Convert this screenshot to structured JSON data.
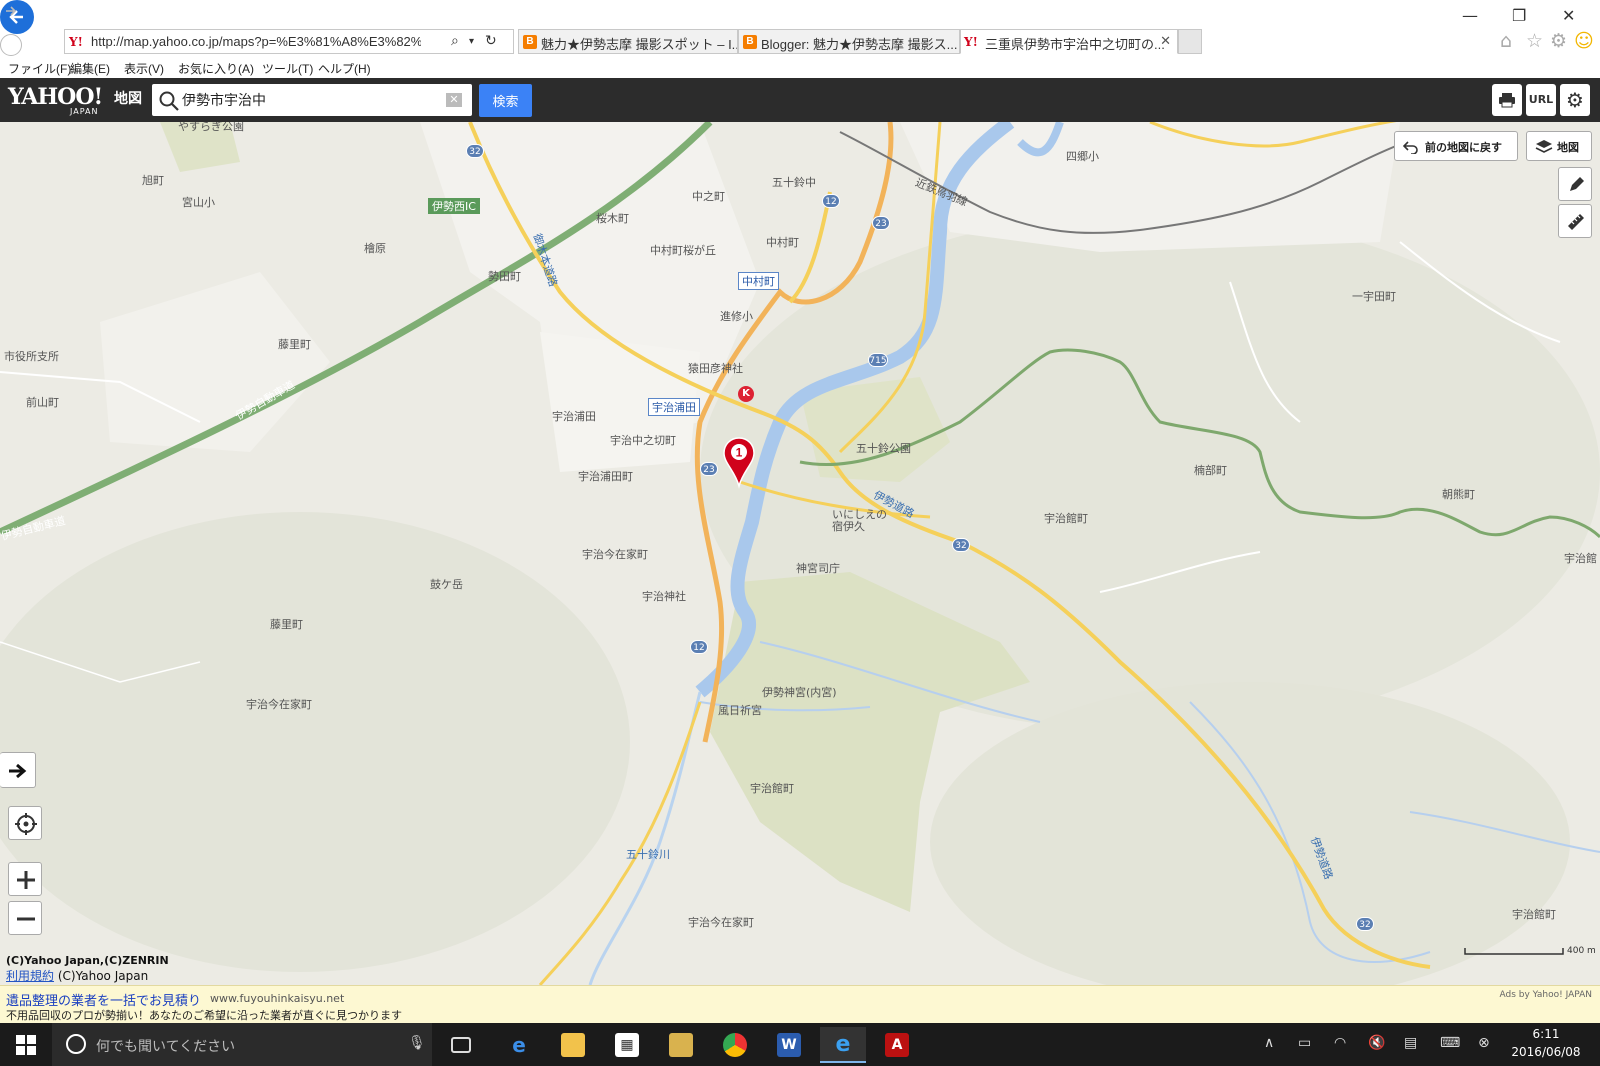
{
  "browser": {
    "url": "http://map.yahoo.co.jp/maps?p=%E3%81%A8%E3%82%82%",
    "tabs": [
      {
        "label": "魅力★伊勢志摩 撮影スポット – I..."
      },
      {
        "label": "Blogger: 魅力★伊勢志摩 撮影ス..."
      },
      {
        "label": "三重県伊勢市宇治中之切町の..."
      }
    ],
    "menu": [
      "ファイル(F)",
      "編集(E)",
      "表示(V)",
      "お気に入り(A)",
      "ツール(T)",
      "ヘルプ(H)"
    ]
  },
  "header": {
    "logo": "YAHOO!",
    "logo_sub": "JAPAN",
    "logo_map": "地図",
    "search_value": "伊勢市宇治中",
    "search_button": "検索",
    "url_button": "URL"
  },
  "map": {
    "prev_map_button": "前の地図に戻す",
    "layer_button": "地図",
    "copyright": "(C)Yahoo Japan,(C)ZENRIN",
    "terms_link": "利用規約",
    "terms_rest": " (C)Yahoo Japan",
    "scale_label": "400 m",
    "marker_number": "1",
    "labels": {
      "yasuragi": "やすらぎ公園",
      "asahi": "旭町",
      "miyayama": "宮山小",
      "ise_nishi_ic": "伊勢西IC",
      "hiki": "檜原",
      "seta": "勢田町",
      "fujisato": "藤里町",
      "shiyakusho": "市役所支所",
      "maeyama": "前山町",
      "ise_expressway1": "伊勢自動車道",
      "ise_expressway2": "伊勢自動車道",
      "sakuragi": "桜木町",
      "nakano": "中之町",
      "isuzu_jh": "五十鈴中",
      "nakamura": "中村町",
      "nakamura_sakura": "中村町桜が丘",
      "nakamura_st": "中村町",
      "shinshu": "進修小",
      "sarutahiko": "猿田彦神社",
      "ujiurata_st": "宇治浦田",
      "ujiurata": "宇治浦田",
      "uji_nakanokiri": "宇治中之切町",
      "ujiurata_machi": "宇治浦田町",
      "isuzu_park": "五十鈴公園",
      "inishie": "いにしえの",
      "inishie2": "宿伊久",
      "ise_michi": "伊勢道路",
      "jingu_shicho": "神宮司庁",
      "uji_imazaike1": "宇治今在家町",
      "kodaka": "鼓ケ岳",
      "uji_jinja": "宇治神社",
      "fujisato2": "藤里町",
      "uji_imazaike2": "宇治今在家町",
      "naiku": "伊勢神宮(内宮)",
      "kazahinomi": "風日祈宮",
      "uji_tachi1": "宇治館町",
      "isuzugawa": "五十鈴川",
      "uji_imazaike3": "宇治今在家町",
      "kintetsu": "近鉄鳥羽線",
      "yonegi": "四郷小",
      "ichiuda": "一宇田町",
      "kusube": "楠部町",
      "uji_tachi2": "宇治館町",
      "asama": "朝熊町",
      "uji_tachi3": "宇治館",
      "uji_tachi4": "宇治館町",
      "ise_michi2": "伊勢道路",
      "okimotomichi": "御木本道路"
    },
    "routes": [
      "32",
      "12",
      "23",
      "23",
      "12",
      "32",
      "715",
      "32"
    ]
  },
  "ad": {
    "title": "遺品整理の業者を一括でお見積り",
    "url": "www.fuyouhinkaisyu.net",
    "desc": "不用品回収のプロが勢揃い！あなたのご希望に沿った業者が直ぐに見つかります",
    "by": "Ads by Yahoo! JAPAN"
  },
  "taskbar": {
    "search_placeholder": "何でも聞いてください",
    "time": "6:11",
    "date": "2016/06/08"
  }
}
